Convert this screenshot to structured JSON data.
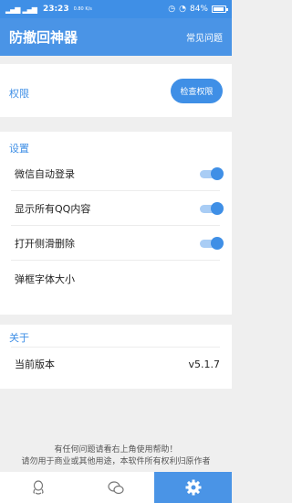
{
  "status_bar": {
    "signal1": "4G",
    "signal2": "4G",
    "time": "23:23",
    "speed": "0.80 K/s",
    "battery": "84%",
    "battery_level": 0.84
  },
  "app": {
    "title": "防撤回神器",
    "help_link": "常见问题"
  },
  "permission": {
    "title": "权限",
    "button": "检查权限"
  },
  "settings": {
    "title": "设置",
    "items": [
      {
        "label": "微信自动登录",
        "enabled": true
      },
      {
        "label": "显示所有QQ内容",
        "enabled": true
      },
      {
        "label": "打开侧滑删除",
        "enabled": true
      },
      {
        "label": "弹框字体大小"
      }
    ]
  },
  "about": {
    "title": "关于",
    "version_label": "当前版本",
    "version_value": "v5.1.7"
  },
  "footer": {
    "line1": "有任何问题请看右上角使用帮助！",
    "line2": "请勿用于商业或其他用途，本软件所有权利归原作者"
  },
  "tabs": [
    {
      "icon": "qq-icon",
      "active": false
    },
    {
      "icon": "wechat-icon",
      "active": false
    },
    {
      "icon": "gear-icon",
      "active": true
    }
  ],
  "colors": {
    "accent": "#3f8fe6",
    "background": "#efefef",
    "toggle_track": "#a9cdf5"
  }
}
